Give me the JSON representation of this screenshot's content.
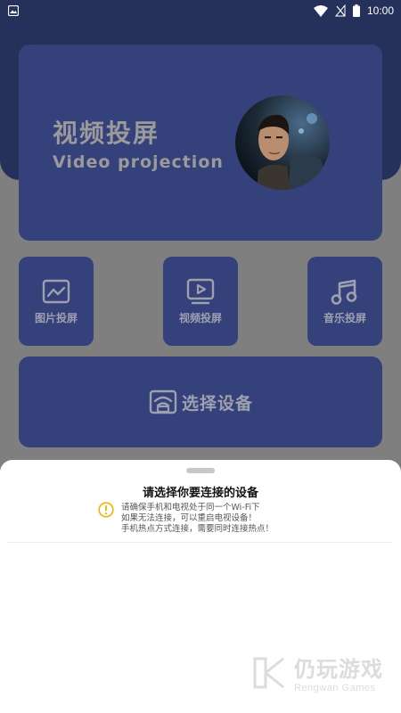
{
  "status_bar": {
    "time": "10:00",
    "icons": [
      "image-icon",
      "wifi-icon",
      "signal-off-icon",
      "battery-icon"
    ]
  },
  "hero": {
    "title_cn": "视频投屏",
    "title_en": "Video projection",
    "avatar": "avatar-photo"
  },
  "tiles": [
    {
      "label": "图片投屏",
      "icon": "image-chart-icon"
    },
    {
      "label": "视频投屏",
      "icon": "video-screen-icon"
    },
    {
      "label": "音乐投屏",
      "icon": "music-note-icon"
    }
  ],
  "select_device": {
    "label": "选择设备",
    "icon": "cast-device-icon"
  },
  "sheet": {
    "heading": "请选择你要连接的设备",
    "notes": [
      "请确保手机和电视处于同一个Wi-Fi下",
      "如果无法连接，可以重启电视设备！",
      "手机热点方式连接，需要同时连接热点！"
    ]
  },
  "watermark": {
    "cn": "仍玩游戏",
    "en": "Rengwan Games"
  },
  "colors": {
    "primary": "#34417a",
    "dark": "#25315a",
    "overlay": "#7f7f7f",
    "warning": "#f0b400"
  }
}
